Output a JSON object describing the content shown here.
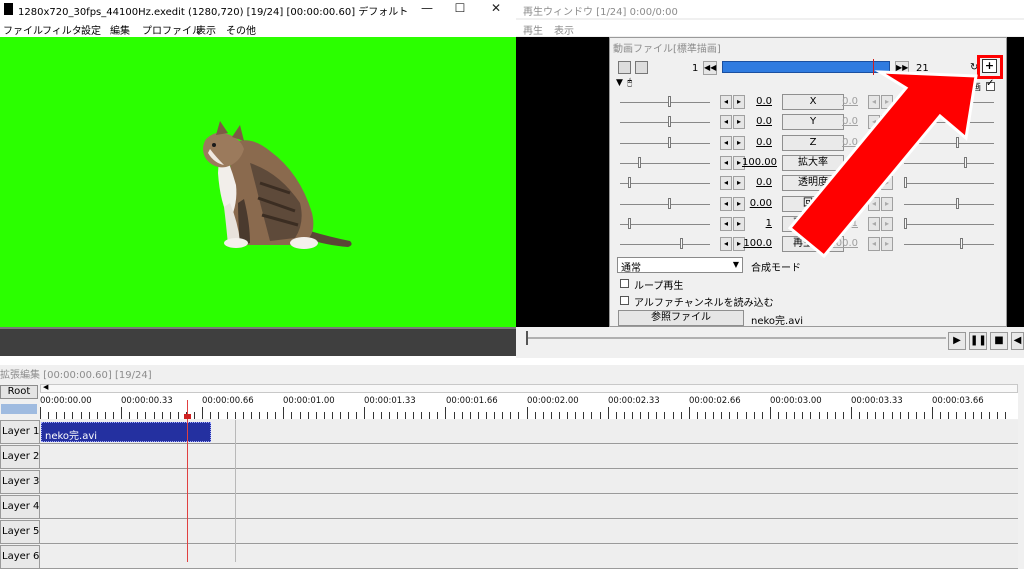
{
  "main_window": {
    "title": "1280x720_30fps_44100Hz.exedit (1280,720)  [19/24] [00:00:00.60]  デフォルト",
    "menu": [
      "ファイル",
      "フィルタ",
      "設定",
      "編集",
      "プロファイル",
      "表示",
      "その他"
    ],
    "window_buttons": [
      "—",
      "☐",
      "✕"
    ]
  },
  "playback_window": {
    "title": "再生ウィンドウ [1/24]  0:00/0:00",
    "menu": [
      "再生",
      "表示"
    ],
    "buttons": [
      "▶",
      "❚❚",
      "■",
      "◀"
    ]
  },
  "object_dialog": {
    "title": "動画ファイル[標準描画]",
    "frame_start": "1",
    "frame_end": "21",
    "params": [
      {
        "label": "X",
        "value": "0.0",
        "end_value": "0.0"
      },
      {
        "label": "Y",
        "value": "0.0",
        "end_value": "0.0"
      },
      {
        "label": "Z",
        "value": "0.0",
        "end_value": "0.0"
      },
      {
        "label": "拡大率",
        "value": "100.00",
        "end_value": ""
      },
      {
        "label": "透明度",
        "value": "0.0",
        "end_value": ""
      },
      {
        "label": "回転",
        "value": "0.00",
        "end_value": "0.00"
      },
      {
        "label": "再生位置",
        "value": "1",
        "end_value": "1"
      },
      {
        "label": "再生速度",
        "value": "100.0",
        "end_value": "100.0"
      }
    ],
    "blend_mode_value": "通常",
    "blend_mode_label": "合成モード",
    "loop_label": "ループ再生",
    "alpha_label": "アルファチャンネルを読み込む",
    "ref_file_button": "参照ファイル",
    "file_name": "neko完.avi",
    "plus_button": "+",
    "cut_label": "画"
  },
  "timeline": {
    "title": "拡張編集 [00:00:00.60] [19/24]",
    "root_label": "Root",
    "time_labels": [
      "00:00:00.00",
      "00:00:00.33",
      "00:00:00.66",
      "00:00:01.00",
      "00:00:01.33",
      "00:00:01.66",
      "00:00:02.00",
      "00:00:02.33",
      "00:00:02.66",
      "00:00:03.00",
      "00:00:03.33",
      "00:00:03.66"
    ],
    "layers": [
      "Layer 1",
      "Layer 2",
      "Layer 3",
      "Layer 4",
      "Layer 5",
      "Layer 6"
    ],
    "clip_label": "neko完.avi"
  },
  "colors": {
    "preview_bg": "#2bff00",
    "clip": "#2430a0",
    "annotation": "#ff0000",
    "seek_bar": "#2f7be0"
  }
}
